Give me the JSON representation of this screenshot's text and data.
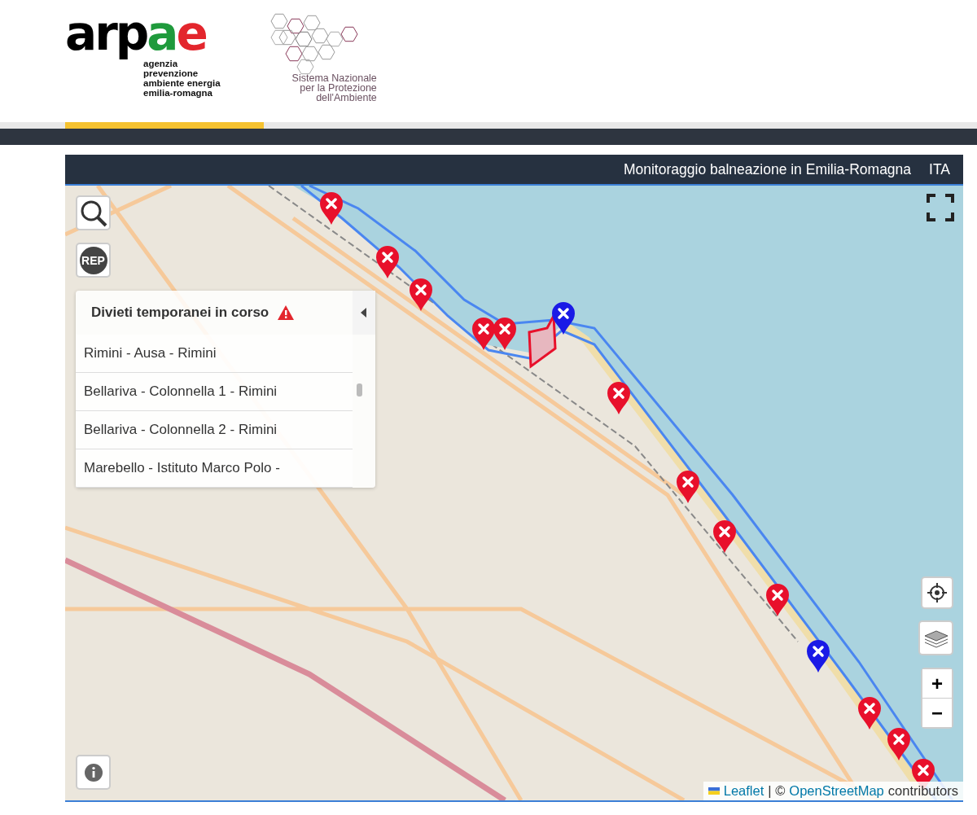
{
  "logo": {
    "wordmark": [
      {
        "text": "arp",
        "color": "#000000"
      },
      {
        "text": "a",
        "color": "#1f9a3c"
      },
      {
        "text": "e",
        "color": "#e3262d"
      }
    ],
    "tagline": [
      "agenzia",
      "prevenzione",
      "ambiente energia",
      "emilia-romagna"
    ]
  },
  "partner_logo": {
    "lines": [
      "Sistema Nazionale",
      "per la Protezione",
      "dell'Ambiente"
    ]
  },
  "map_header": {
    "title": "Monitoraggio balneazione in Emilia-Romagna",
    "language": "ITA"
  },
  "map_controls": {
    "rep_button": "REP",
    "zoom_in": "+",
    "zoom_out": "−"
  },
  "bans_panel": {
    "title": "Divieti temporanei in corso",
    "expanded": true,
    "items": [
      "Rimini - Ausa - Rimini",
      "Bellariva - Colonnella 1 - Rimini",
      "Bellariva - Colonnella 2 - Rimini",
      "Marebello - Istituto Marco Polo -"
    ]
  },
  "markers": [
    {
      "color": "#e8102b"
    },
    {
      "color": "#e8102b"
    },
    {
      "color": "#e8102b"
    },
    {
      "color": "#e8102b"
    },
    {
      "color": "#e8102b"
    },
    {
      "color": "#1a1ae6"
    },
    {
      "color": "#e8102b"
    },
    {
      "color": "#e8102b"
    },
    {
      "color": "#e8102b"
    },
    {
      "color": "#e8102b"
    },
    {
      "color": "#1a1ae6"
    },
    {
      "color": "#e8102b"
    },
    {
      "color": "#e8102b"
    },
    {
      "color": "#e8102b"
    }
  ],
  "attribution": {
    "leaflet": "Leaflet",
    "separator": "| ©",
    "osm": "OpenStreetMap",
    "suffix": "contributors"
  }
}
